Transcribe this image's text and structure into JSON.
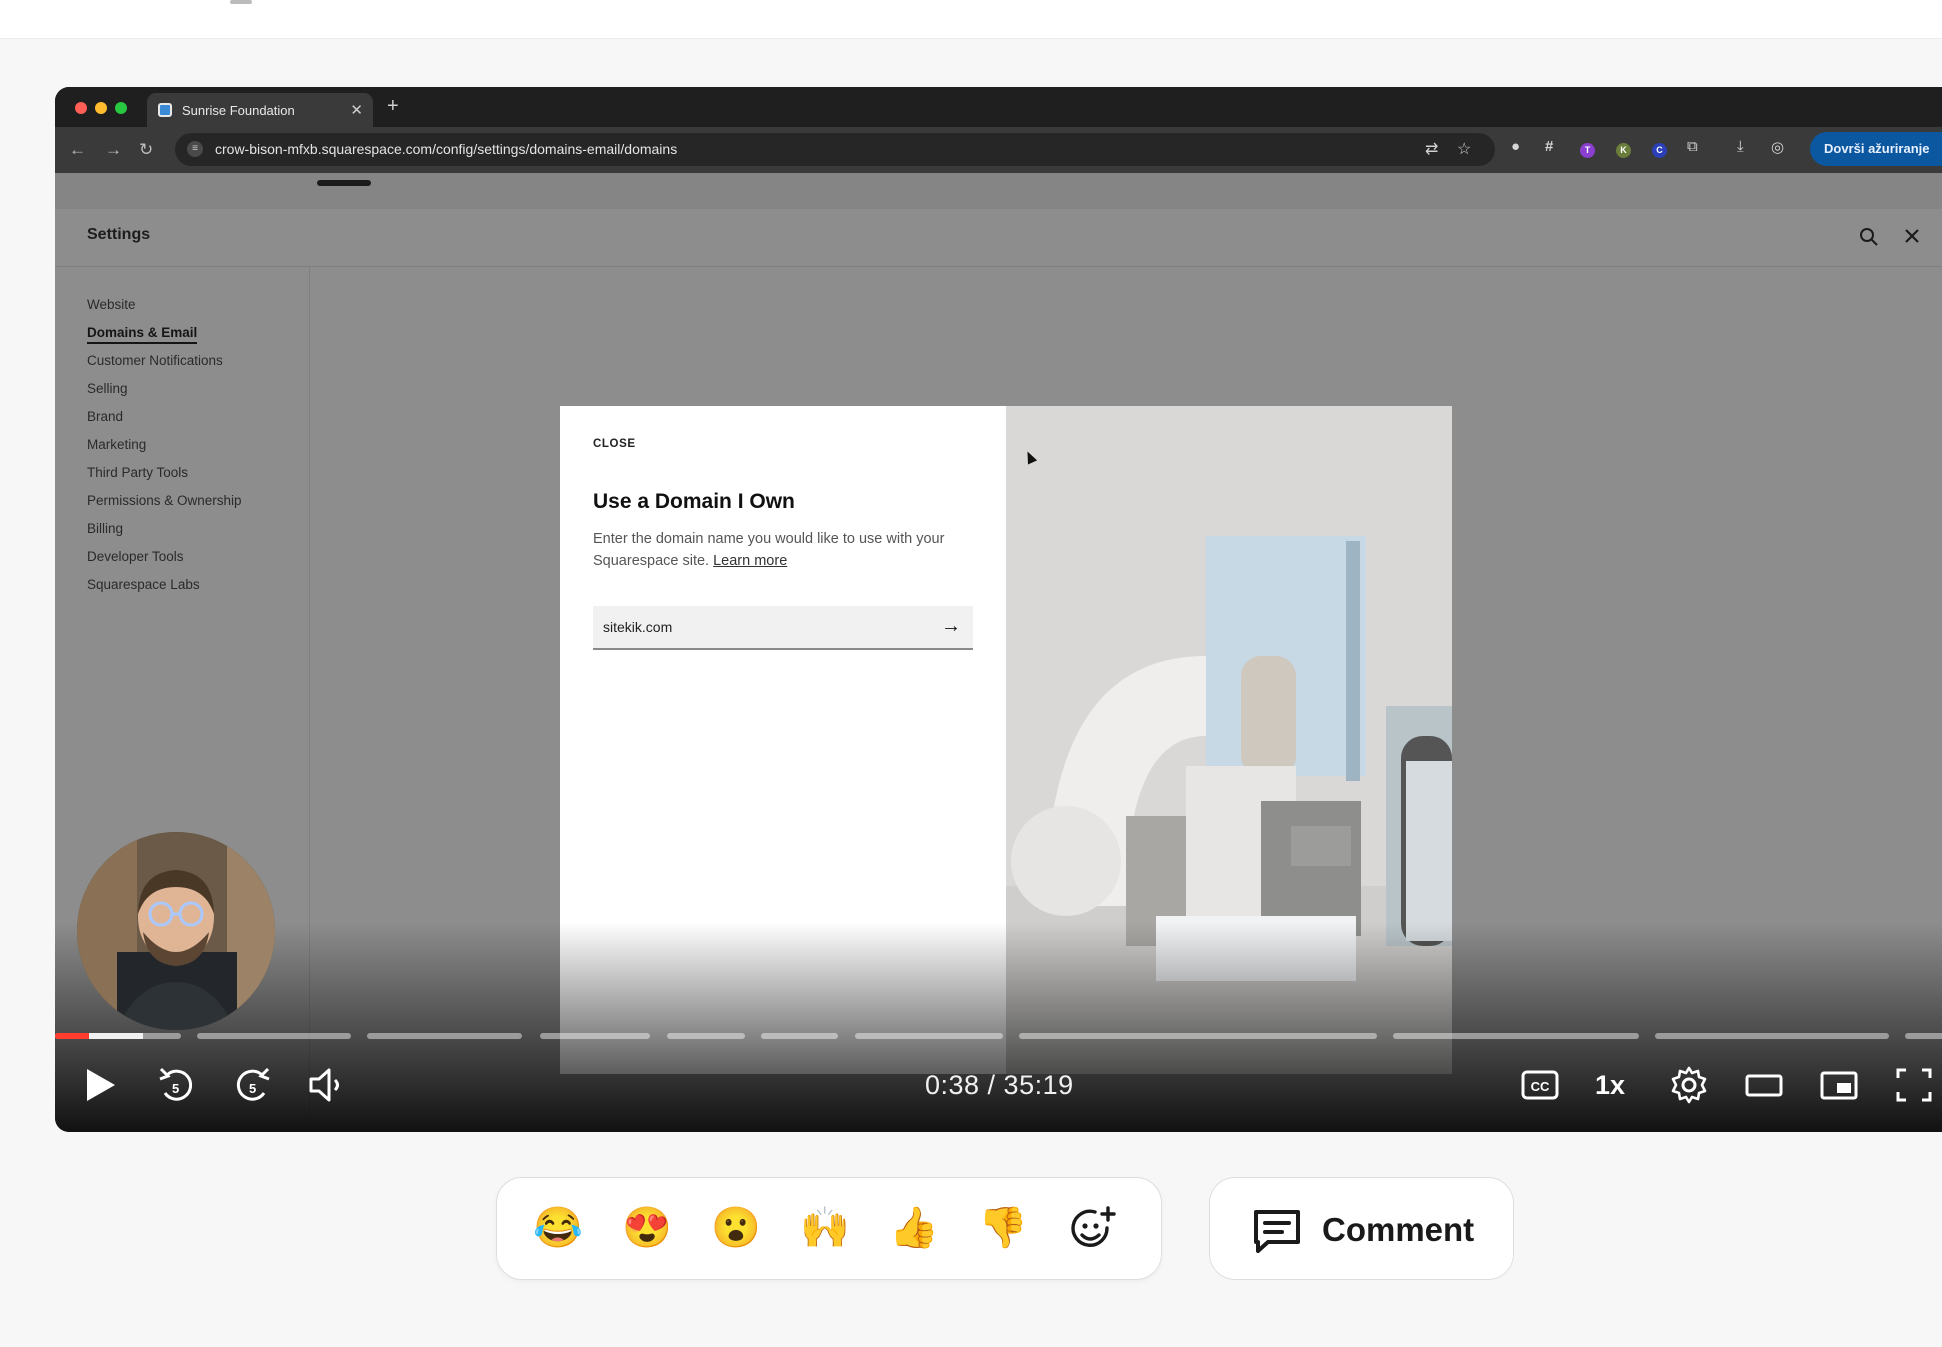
{
  "browser": {
    "tab_title": "Sunrise Foundation",
    "url": "crow-bison-mfxb.squarespace.com/config/settings/domains-email/domains",
    "update_label": "Dovrši ažuriranje"
  },
  "settings": {
    "title": "Settings",
    "nav": [
      "Website",
      "Domains & Email",
      "Customer Notifications",
      "Selling",
      "Brand",
      "Marketing",
      "Third Party Tools",
      "Permissions & Ownership",
      "Billing",
      "Developer Tools",
      "Squarespace Labs"
    ],
    "active_item": "Domains & Email"
  },
  "modal": {
    "close_label": "CLOSE",
    "title": "Use a Domain I Own",
    "description": "Enter the domain name you would like to use with your Squarespace site.",
    "learn_more": "Learn more",
    "domain_value": "sitekik.com"
  },
  "player": {
    "time_display": "0:38 / 35:19",
    "speed_label": "1x",
    "cc_label": "CC",
    "skip_back": "5",
    "skip_forward": "5",
    "progress_fraction": 0.018
  },
  "reactions": {
    "emojis": [
      "😂",
      "😍",
      "😮",
      "🙌",
      "👍",
      "👎"
    ],
    "add_icon": "add-reaction-icon"
  },
  "comment": {
    "label": "Comment",
    "icon": "comment-icon"
  },
  "colors": {
    "progress_played": "#ff3d2e",
    "update_button": "#0b57a0",
    "page_background": "#f7f7f7"
  }
}
